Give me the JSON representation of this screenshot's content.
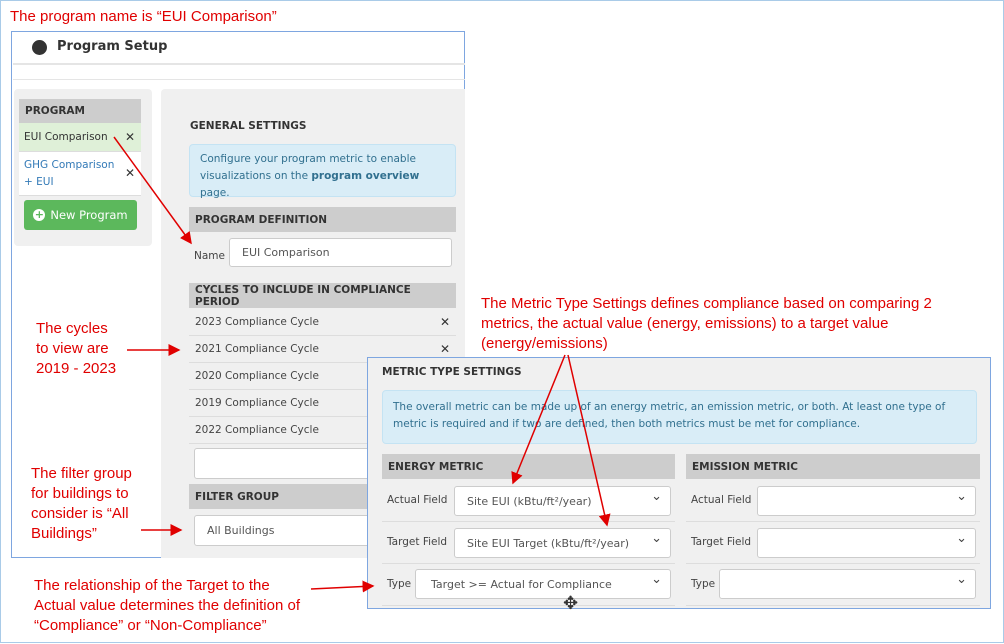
{
  "annotations": {
    "program_name": "The program name is “EUI Comparison”",
    "metric_type": [
      "The Metric Type Settings defines compliance based on comparing 2",
      "metrics, the actual value (energy, emissions) to a target value",
      "(energy/emissions)"
    ],
    "cycles": [
      "The cycles",
      "to view are",
      "2019 - 2023"
    ],
    "filter": [
      "The filter group",
      "for buildings to",
      "consider is “All",
      "Buildings”"
    ],
    "relationship": [
      "The relationship of the Target to the",
      "Actual value determines the definition of",
      "“Compliance” or “Non-Compliance”"
    ]
  },
  "header": {
    "title": "Program Setup",
    "icon": "dashboard-icon"
  },
  "sidebar": {
    "heading": "PROGRAM",
    "items": [
      {
        "label": "EUI Comparison"
      },
      {
        "label": "GHG Comparison + EUI"
      }
    ],
    "new_button": "New Program"
  },
  "general": {
    "title": "GENERAL SETTINGS",
    "info_pre": "Configure your program metric to enable visualizations on the ",
    "info_link": "program overview",
    "info_post": " page."
  },
  "definition": {
    "heading": "PROGRAM DEFINITION",
    "name_label": "Name",
    "name_value": "EUI Comparison"
  },
  "cycles": {
    "heading": "CYCLES TO INCLUDE IN COMPLIANCE PERIOD",
    "items": [
      "2023 Compliance Cycle",
      "2021 Compliance Cycle",
      "2020 Compliance Cycle",
      "2019 Compliance Cycle",
      "2022 Compliance Cycle"
    ]
  },
  "filter": {
    "heading": "FILTER GROUP",
    "value": "All Buildings"
  },
  "metric": {
    "title": "METRIC TYPE SETTINGS",
    "info": "The overall metric can be made up of an energy metric, an emission metric, or both. At least one type of metric is required and if two are defined, then both metrics must be met for compliance.",
    "energy": {
      "heading": "ENERGY METRIC",
      "actual_label": "Actual Field",
      "actual_value": "Site EUI (kBtu/ft²/year)",
      "target_label": "Target Field",
      "target_value": "Site EUI Target (kBtu/ft²/year)",
      "type_label": "Type",
      "type_value": "Target >= Actual for Compliance"
    },
    "emission": {
      "heading": "EMISSION METRIC",
      "actual_label": "Actual Field",
      "target_label": "Target Field",
      "type_label": "Type"
    }
  }
}
